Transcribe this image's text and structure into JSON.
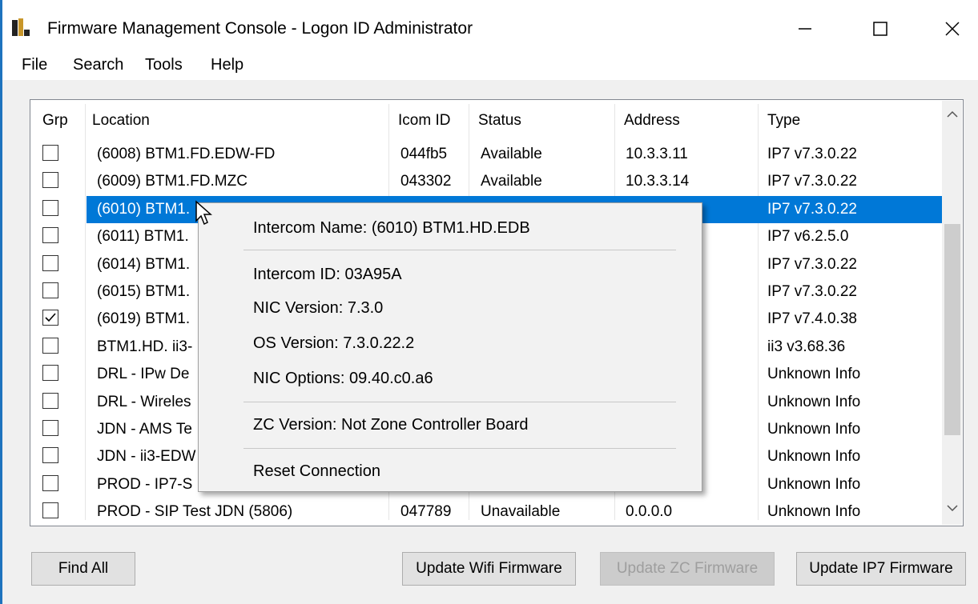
{
  "window": {
    "title": "Firmware Management Console - Logon ID Administrator",
    "controls": {
      "minimize": "—",
      "maximize": "☐",
      "close": "✕"
    }
  },
  "menu": [
    "File",
    "Search",
    "Tools",
    "Help"
  ],
  "table": {
    "columns": [
      "Grp",
      "Location",
      "Icom ID",
      "Status",
      "Address",
      "Type"
    ],
    "rows": [
      {
        "checked": false,
        "location": "(6008) BTM1.FD.EDW-FD",
        "icom": "044fb5",
        "status": "Available",
        "address": "10.3.3.11",
        "type": "IP7 v7.3.0.22"
      },
      {
        "checked": false,
        "location": "(6009) BTM1.FD.MZC",
        "icom": "043302",
        "status": "Available",
        "address": "10.3.3.14",
        "type": "IP7 v7.3.0.22"
      },
      {
        "checked": false,
        "location": "(6010) BTM1.",
        "icom": "",
        "status": "",
        "address": "",
        "type": "IP7 v7.3.0.22",
        "selected": true
      },
      {
        "checked": false,
        "location": "(6011) BTM1.",
        "icom": "",
        "status": "",
        "address": "",
        "type": "IP7 v6.2.5.0"
      },
      {
        "checked": false,
        "location": "(6014) BTM1.",
        "icom": "",
        "status": "",
        "address": "",
        "type": "IP7 v7.3.0.22"
      },
      {
        "checked": false,
        "location": "(6015) BTM1.",
        "icom": "",
        "status": "",
        "address": "",
        "type": "IP7 v7.3.0.22"
      },
      {
        "checked": true,
        "location": "(6019) BTM1.",
        "icom": "",
        "status": "",
        "address": "",
        "type": "IP7 v7.4.0.38"
      },
      {
        "checked": false,
        "location": "BTM1.HD. ii3-",
        "icom": "",
        "status": "",
        "address": "",
        "type": "ii3 v3.68.36"
      },
      {
        "checked": false,
        "location": "DRL - IPw De",
        "icom": "",
        "status": "",
        "address": "",
        "type": "Unknown Info"
      },
      {
        "checked": false,
        "location": "DRL - Wireles",
        "icom": "",
        "status": "",
        "address": "",
        "type": "Unknown Info"
      },
      {
        "checked": false,
        "location": "JDN - AMS Te",
        "icom": "",
        "status": "",
        "address": "",
        "type": "Unknown Info"
      },
      {
        "checked": false,
        "location": "JDN - ii3-EDW",
        "icom": "",
        "status": "",
        "address": "",
        "type": "Unknown Info"
      },
      {
        "checked": false,
        "location": "PROD - IP7-S",
        "icom": "",
        "status": "",
        "address": "",
        "type": "Unknown Info"
      },
      {
        "checked": false,
        "location": "PROD - SIP Test JDN (5806)",
        "icom": "047789",
        "status": "Unavailable",
        "address": "0.0.0.0",
        "type": "Unknown Info"
      }
    ]
  },
  "context_menu": {
    "intercom_name": "Intercom Name: (6010) BTM1.HD.EDB",
    "intercom_id": "Intercom ID: 03A95A",
    "nic_version": "NIC Version: 7.3.0",
    "os_version": "OS Version: 7.3.0.22.2",
    "nic_options": "NIC Options: 09.40.c0.a6",
    "zc_version": "ZC Version: Not Zone Controller Board",
    "reset": "Reset Connection"
  },
  "buttons": {
    "find_all": "Find All",
    "update_wifi": "Update Wifi Firmware",
    "update_zc": "Update ZC Firmware",
    "update_ip7": "Update IP7 Firmware"
  },
  "colors": {
    "selection": "#0078d7",
    "window_border": "#1e73be"
  }
}
